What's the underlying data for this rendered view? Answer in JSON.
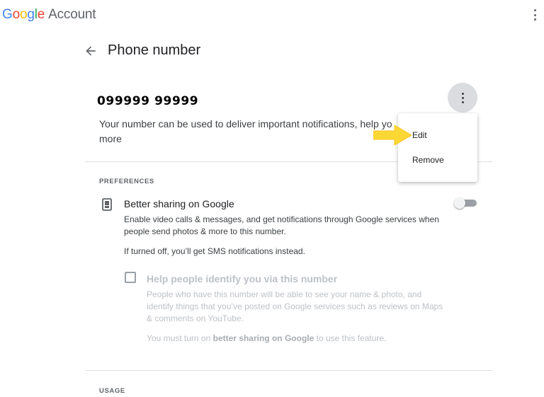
{
  "header": {
    "logo": {
      "g1": "G",
      "g2": "o",
      "g3": "o",
      "g4": "g",
      "g5": "l",
      "g6": "e"
    },
    "account_label": "Account",
    "menu_icon": "more-vert-icon"
  },
  "page": {
    "back_icon": "arrow-back-icon",
    "title": "Phone number"
  },
  "phone": {
    "number": "099999 99999",
    "description": "Your number can be used to deliver important notifications, help yo",
    "description_more": "more",
    "menu_icon": "more-vert-icon"
  },
  "menu": {
    "items": [
      {
        "label": "Edit"
      },
      {
        "label": "Remove"
      }
    ]
  },
  "preferences": {
    "section_label": "PREFERENCES",
    "better_sharing": {
      "icon": "phone-icon",
      "title": "Better sharing on Google",
      "description": "Enable video calls & messages, and get notifications through Google services when people send photos & more to this number.",
      "note": "If turned off, you’ll get SMS notifications instead.",
      "enabled": false
    },
    "help_identify": {
      "title": "Help people identify you via this number",
      "description": "People who have this number will be able to see your name & photo, and identify things that you’ve posted on Google services such as reviews on Maps & comments on YouTube.",
      "note_prefix": "You must turn on ",
      "note_bold": "better sharing on Google",
      "note_suffix": " to use this feature.",
      "checked": false
    }
  },
  "usage": {
    "section_label": "USAGE"
  },
  "colors": {
    "arrow_annotation": "#fdd835",
    "google_blue": "#4285f4",
    "google_red": "#ea4335",
    "google_yellow": "#fbbc05",
    "google_green": "#34a853"
  }
}
